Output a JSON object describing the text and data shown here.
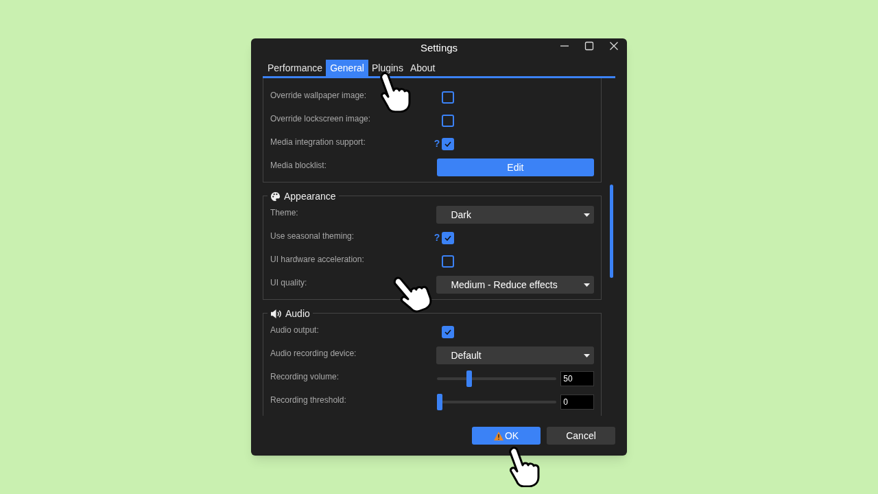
{
  "window": {
    "title": "Settings"
  },
  "tabs": [
    {
      "label": "Performance",
      "selected": false
    },
    {
      "label": "General",
      "selected": true
    },
    {
      "label": "Plugins",
      "selected": false
    },
    {
      "label": "About",
      "selected": false
    }
  ],
  "sections": [
    {
      "rows": [
        {
          "kind": "checkbox",
          "label": "Override wallpaper image:",
          "checked": false
        },
        {
          "kind": "checkbox",
          "label": "Override lockscreen image:",
          "checked": false
        },
        {
          "kind": "checkbox",
          "label": "Media integration support:",
          "checked": true,
          "help": "?"
        },
        {
          "kind": "button",
          "label": "Media blocklist:",
          "button": "Edit"
        }
      ]
    },
    {
      "title": "Appearance",
      "rows": [
        {
          "kind": "dropdown",
          "label": "Theme:",
          "value": "Dark"
        },
        {
          "kind": "checkbox",
          "label": "Use seasonal theming:",
          "checked": true,
          "help": "?"
        },
        {
          "kind": "checkbox",
          "label": "UI hardware acceleration:",
          "checked": false
        },
        {
          "kind": "dropdown",
          "label": "UI quality:",
          "value": "Medium - Reduce effects"
        }
      ]
    },
    {
      "title": "Audio",
      "rows": [
        {
          "kind": "checkbox",
          "label": "Audio output:",
          "checked": true
        },
        {
          "kind": "dropdown",
          "label": "Audio recording device:",
          "value": "Default"
        },
        {
          "kind": "slider",
          "label": "Recording volume:",
          "level": 0.25,
          "value": "50"
        },
        {
          "kind": "slider",
          "label": "Recording threshold:",
          "level": 0,
          "value": "0"
        }
      ]
    }
  ],
  "buttons": [
    {
      "label": "OK",
      "kind": "primary",
      "warning": true
    },
    {
      "label": "Cancel",
      "kind": "secondary",
      "warning": false
    }
  ]
}
